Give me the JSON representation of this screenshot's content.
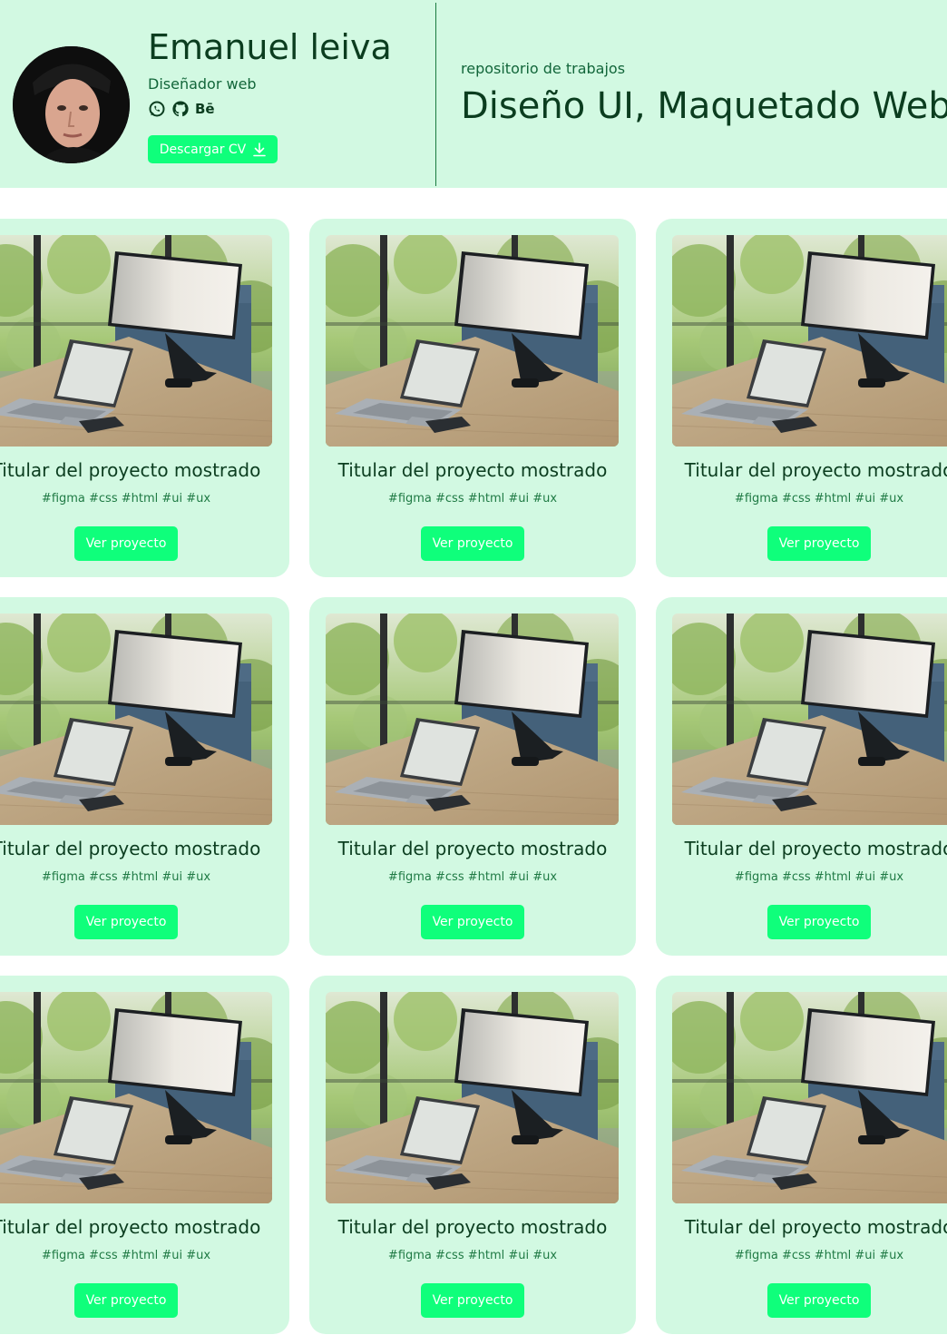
{
  "profile": {
    "name": "Emanuel leiva",
    "role": "Diseñador web",
    "behance_label": "Bē",
    "cv_button": "Descargar CV",
    "icons": [
      "whatsapp-icon",
      "github-icon",
      "behance-icon",
      "download-icon"
    ]
  },
  "intro": {
    "label": "repositorio de trabajos",
    "headline": "Diseño UI, Maquetado Web"
  },
  "projects": [
    {
      "title": "Titular del proyecto mostrado",
      "tags": "#figma #css #html #ui #ux",
      "button": "Ver proyecto"
    },
    {
      "title": "Titular del proyecto mostrado",
      "tags": "#figma #css #html #ui #ux",
      "button": "Ver proyecto"
    },
    {
      "title": "Titular del proyecto mostrado",
      "tags": "#figma #css #html #ui #ux",
      "button": "Ver proyecto"
    },
    {
      "title": "Titular del proyecto mostrado",
      "tags": "#figma #css #html #ui #ux",
      "button": "Ver proyecto"
    },
    {
      "title": "Titular del proyecto mostrado",
      "tags": "#figma #css #html #ui #ux",
      "button": "Ver proyecto"
    },
    {
      "title": "Titular del proyecto mostrado",
      "tags": "#figma #css #html #ui #ux",
      "button": "Ver proyecto"
    },
    {
      "title": "Titular del proyecto mostrado",
      "tags": "#figma #css #html #ui #ux",
      "button": "Ver proyecto"
    },
    {
      "title": "Titular del proyecto mostrado",
      "tags": "#figma #css #html #ui #ux",
      "button": "Ver proyecto"
    },
    {
      "title": "Titular del proyecto mostrado",
      "tags": "#figma #css #html #ui #ux",
      "button": "Ver proyecto"
    }
  ],
  "colors": {
    "header_bg": "#d2f9e2",
    "card_bg": "#d2f9e2",
    "accent": "#0fff7b",
    "text_dark": "#0b3d1f",
    "text_green": "#12663a"
  }
}
